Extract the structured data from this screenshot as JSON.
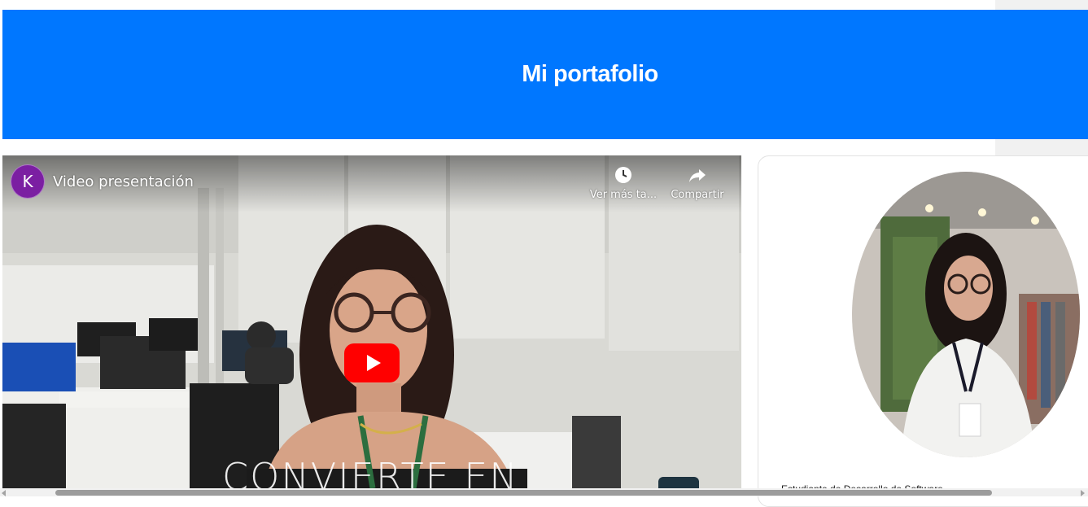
{
  "header": {
    "title": "Mi portafolio"
  },
  "video": {
    "channel_initial": "K",
    "title": "Video presentación",
    "watch_later_label": "Ver más ta...",
    "share_label": "Compartir",
    "overlay_text": "CONVIERTE EN",
    "play_icon": "play-icon"
  },
  "profile": {
    "bio_text": "Estudiante de Desarrollo de Software ..."
  },
  "colors": {
    "header_bg": "#0077ff",
    "play_button": "#ff0000",
    "channel_avatar": "#7b1fa2"
  }
}
